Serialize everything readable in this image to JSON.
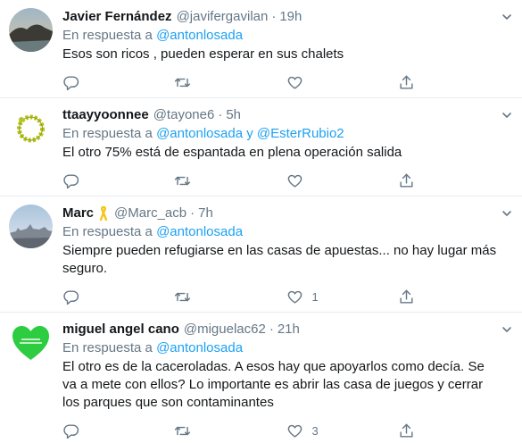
{
  "replies": [
    {
      "name": "Javier Fernández",
      "handle": "@javifergavilan",
      "time": "19h",
      "reply_prefix": "En respuesta a",
      "mentions": "@antonlosada",
      "text": "Esos son ricos , pueden esperar en sus chalets",
      "counts": {
        "reply": "",
        "retweet": "",
        "like": ""
      }
    },
    {
      "name": "ttaayyoonnee",
      "handle": "@tayone6",
      "time": "5h",
      "reply_prefix": "En respuesta a",
      "mentions": "@antonlosada y @EsterRubio2",
      "text": "El otro 75% está de espantada en plena operación salida",
      "counts": {
        "reply": "",
        "retweet": "",
        "like": ""
      }
    },
    {
      "name": "Marc",
      "handle": "@Marc_acb",
      "time": "7h",
      "reply_prefix": "En respuesta a",
      "mentions": "@antonlosada",
      "text": "Siempre pueden refugiarse en las casas de apuestas... no hay lugar más seguro.",
      "counts": {
        "reply": "",
        "retweet": "",
        "like": "1"
      }
    },
    {
      "name": "miguel angel cano",
      "handle": "@miguelac62",
      "time": "21h",
      "reply_prefix": "En respuesta a",
      "mentions": "@antonlosada",
      "text": "El otro es de la caceroladas. A esos hay que apoyarlos como decía. Se va a mete con ellos? Lo importante es abrir las casa de juegos y cerrar los parques que son contaminantes",
      "counts": {
        "reply": "",
        "retweet": "",
        "like": "3"
      }
    }
  ],
  "separator": "·",
  "colors": {
    "link": "#1da1f2",
    "muted": "#657786",
    "text": "#14171a",
    "border": "#e6ecf0"
  },
  "icons": [
    "reply-icon",
    "retweet-icon",
    "like-icon",
    "share-icon",
    "chevron-down-icon",
    "yellow-ribbon-icon"
  ]
}
